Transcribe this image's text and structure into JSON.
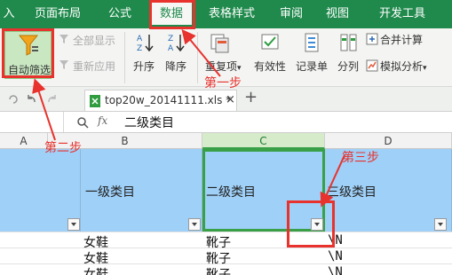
{
  "menu": {
    "items": [
      "入",
      "页面布局",
      "公式",
      "数据",
      "表格样式",
      "审阅",
      "视图",
      "开发工具"
    ],
    "active_index": 3
  },
  "ribbon": {
    "auto_filter": "自动筛选",
    "show_all": "全部显示",
    "reapply": "重新应用",
    "sort_asc": "升序",
    "sort_desc": "降序",
    "duplicates": "重复项",
    "duplicates_arrow": "▾",
    "validity": "有效性",
    "record_form": "记录单",
    "split_column": "分列",
    "merge_calc": "合并计算",
    "what_if": "模拟分析",
    "what_if_arrow": "▾"
  },
  "tabs": {
    "file_tab": "top20w_20141111.xls *",
    "close": "×",
    "add": "+"
  },
  "formula_bar": {
    "fx": "fx",
    "value": "二级类目"
  },
  "columns": [
    "A",
    "B",
    "C",
    "D"
  ],
  "header_row": {
    "b": "一级类目",
    "c": "二级类目",
    "d": "三级类目"
  },
  "rows": [
    {
      "b": "女鞋",
      "c": "靴子",
      "d": "\\N"
    },
    {
      "b": "女鞋",
      "c": "靴子",
      "d": "\\N"
    },
    {
      "b": "女鞋",
      "c": "靴子",
      "d": "\\N"
    }
  ],
  "annotations": {
    "step1": "第一步",
    "step2": "第二步",
    "step3": "第三步",
    "color": "#e8322d"
  },
  "colors": {
    "menu_bg": "#1f8a4c",
    "header_bg": "#9fd0f8",
    "selected_border": "#3aa047"
  }
}
